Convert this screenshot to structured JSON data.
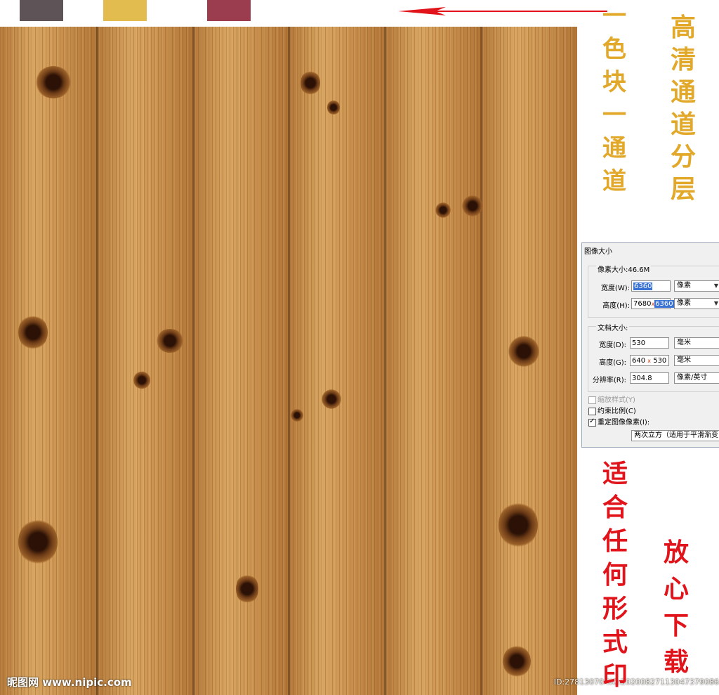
{
  "swatches": [
    {
      "name": "swatch-gray",
      "color": "#5e5458"
    },
    {
      "name": "swatch-gold",
      "color": "#e2bc4e"
    },
    {
      "name": "swatch-maroon",
      "color": "#9b3d4f"
    }
  ],
  "left_caption": [
    "一",
    "色",
    "块",
    "一",
    "通",
    "道"
  ],
  "right_caption": [
    "高",
    "清",
    "通",
    "道",
    "分",
    "层"
  ],
  "bottom_left_caption": [
    "适",
    "合",
    "任",
    "何",
    "形",
    "式",
    "印"
  ],
  "bottom_right_caption": [
    "放",
    "心",
    "下",
    "载"
  ],
  "dialog": {
    "title": "图像大小",
    "pixel_dimensions_label": "像素大小:46.6M",
    "width_label": "宽度(W):",
    "width_value": "6360",
    "height_label": "高度(H):",
    "height_value_old": "7680",
    "height_value_new": "6360",
    "pixel_unit": "像素",
    "doc_size_label": "文档大小:",
    "doc_width_label": "宽度(D):",
    "doc_width_value": "530",
    "doc_height_label": "高度(G):",
    "doc_height_value_old": "640",
    "doc_height_value_new": "530",
    "mm_unit": "毫米",
    "resolution_label": "分辨率(R):",
    "resolution_value": "304.8",
    "resolution_unit": "像素/英寸",
    "scale_styles_label": "缩放样式(Y)",
    "constrain_label": "约束比例(C)",
    "resample_label": "重定图像像素(I):",
    "resample_method": "两次立方（适用于平滑渐变",
    "x_mark": "x"
  },
  "watermark_left": "昵图网 www.nipic.com",
  "watermark_right": "ID:27813070 NO:20200827113047379086"
}
